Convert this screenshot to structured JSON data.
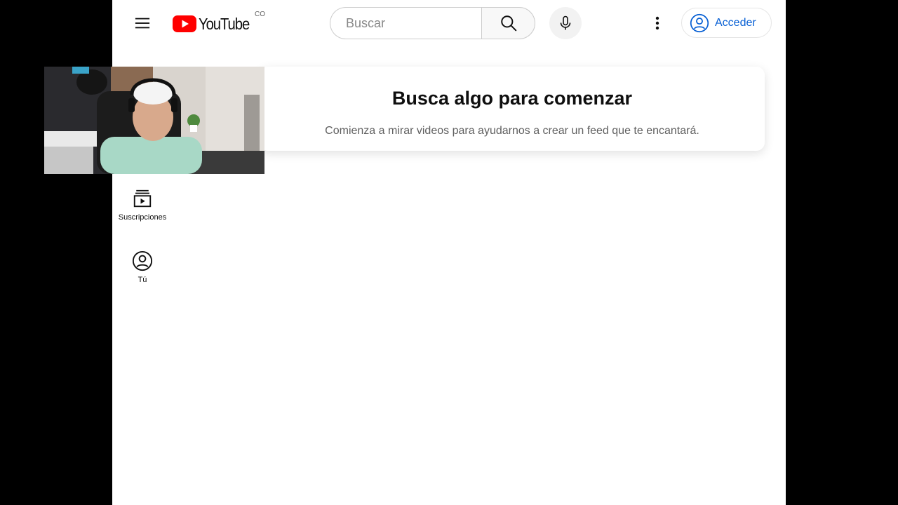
{
  "header": {
    "logo_text": "YouTube",
    "country_code": "CO",
    "search": {
      "placeholder": "Buscar",
      "value": ""
    },
    "signin_label": "Acceder"
  },
  "sidebar": {
    "items": [
      {
        "label": "Suscripciones",
        "icon": "subscriptions-icon"
      },
      {
        "label": "Tú",
        "icon": "account-circle-icon"
      }
    ]
  },
  "feed": {
    "empty_title": "Busca algo para comenzar",
    "empty_subtitle": "Comienza a mirar videos para ayudarnos a crear un feed que te encantará."
  },
  "colors": {
    "brand_red": "#ff0000",
    "link_blue": "#065fd4",
    "letterbox": "#000000"
  }
}
